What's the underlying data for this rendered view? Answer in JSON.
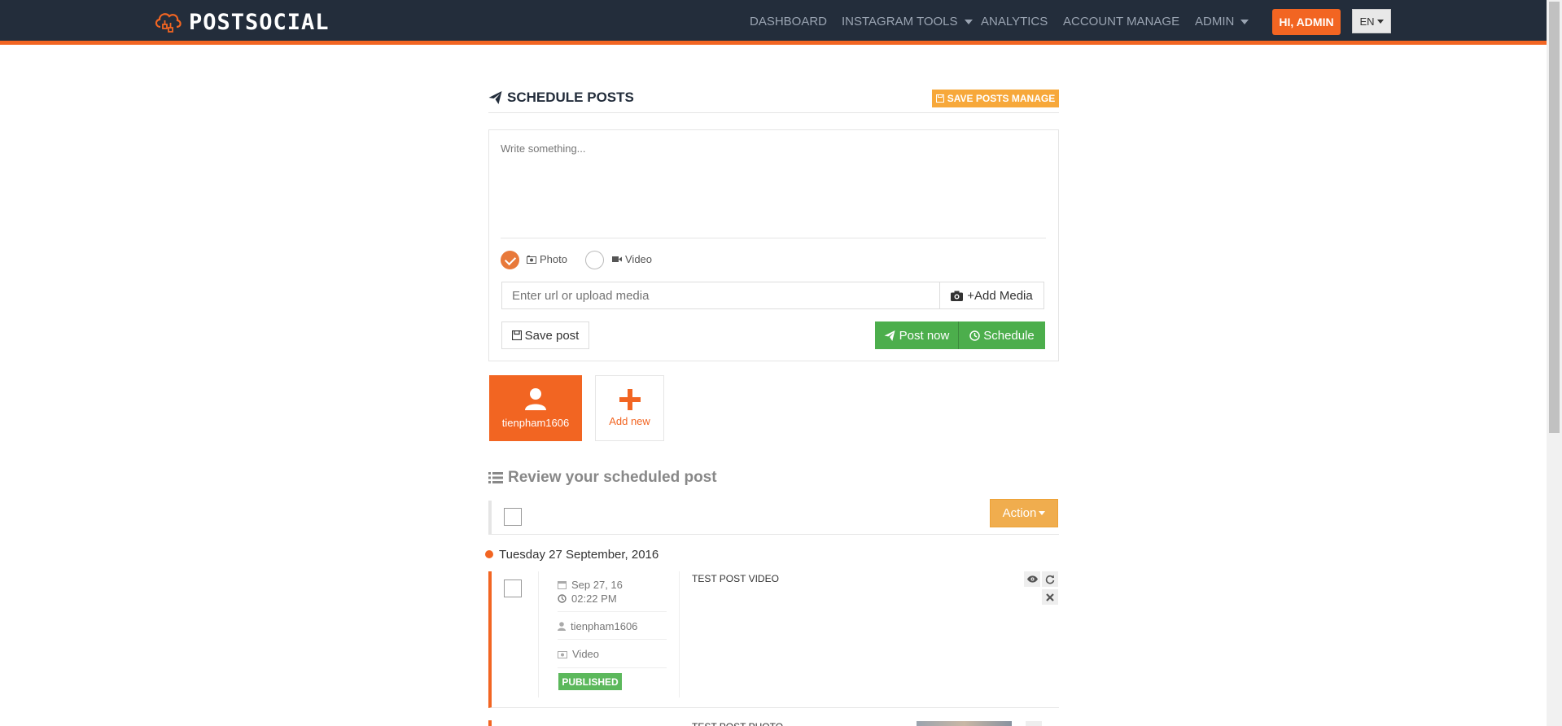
{
  "app": {
    "brand": "POSTSOCIAL",
    "colors": {
      "accent": "#f26522",
      "navbar": "#232d3b",
      "success": "#4cae4c",
      "warning": "#f0ad4e"
    }
  },
  "nav": {
    "items": [
      {
        "label": "DASHBOARD"
      },
      {
        "label": "INSTAGRAM TOOLS",
        "dropdown": true
      },
      {
        "label": "ANALYTICS"
      },
      {
        "label": "ACCOUNT MANAGE"
      },
      {
        "label": "ADMIN",
        "dropdown": true
      }
    ],
    "user_button": "HI, ADMIN",
    "language": "EN"
  },
  "schedule": {
    "title": "SCHEDULE POSTS",
    "save_manage_label": "SAVE POSTS MANAGE",
    "textarea_placeholder": "Write something...",
    "media_types": [
      {
        "label": "Photo",
        "icon": "photo-icon",
        "selected": true
      },
      {
        "label": "Video",
        "icon": "video-camera-icon",
        "selected": false
      }
    ],
    "media_input_placeholder": "Enter url or upload media",
    "add_media_label": "+Add Media",
    "save_post_label": "Save post",
    "post_now_label": "Post now",
    "schedule_label": "Schedule"
  },
  "accounts": {
    "items": [
      {
        "username": "tienpham1606",
        "icon": "user-icon"
      }
    ],
    "add_new_label": "Add new"
  },
  "review": {
    "title": "Review your scheduled post",
    "action_label": "Action",
    "groups": [
      {
        "date": "Tuesday 27 September, 2016",
        "posts": [
          {
            "date": "Sep 27, 16",
            "time": "02:22 PM",
            "account": "tienpham1606",
            "type": "Video",
            "status": "PUBLISHED",
            "caption": "TEST POST VIDEO"
          },
          {
            "caption": "TEST POST PHOTO"
          }
        ]
      }
    ]
  }
}
